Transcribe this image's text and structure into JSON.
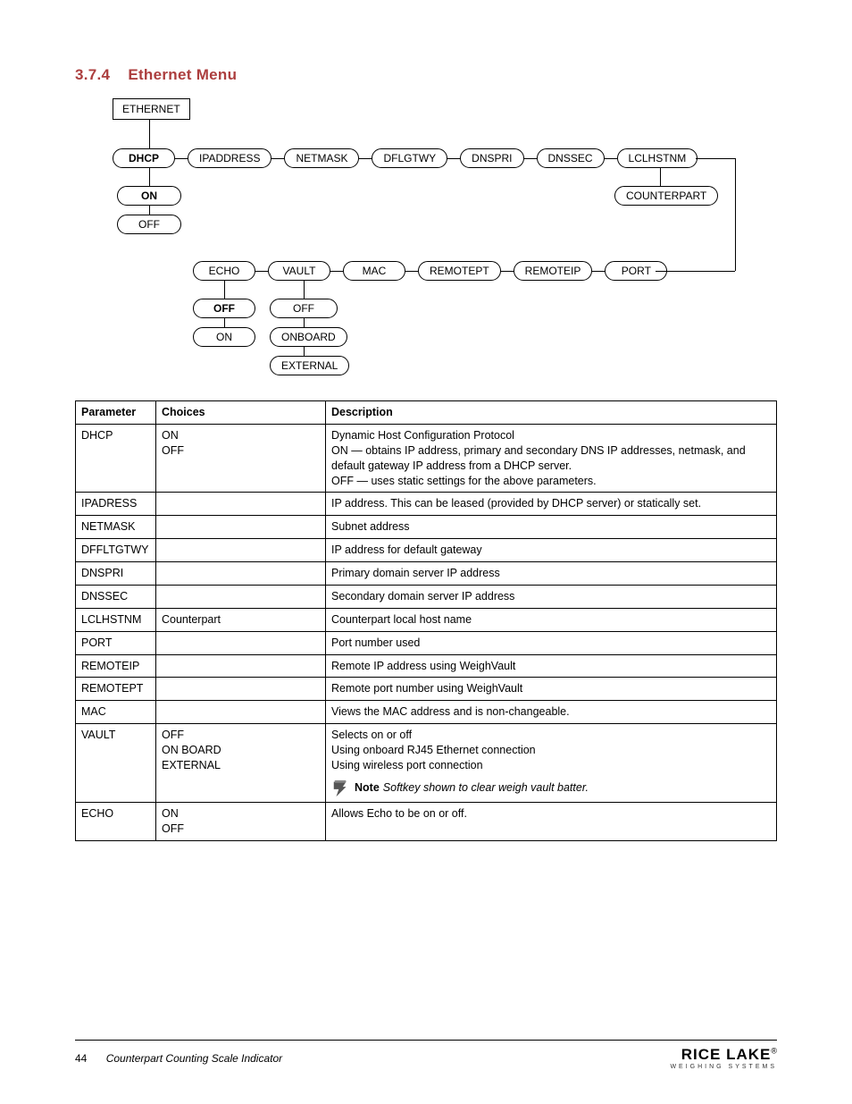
{
  "heading": {
    "number": "3.7.4",
    "title": "Ethernet Menu"
  },
  "diagram": {
    "root": "ETHERNET",
    "row1": [
      "DHCP",
      "IPADDRESS",
      "NETMASK",
      "DFLGTWY",
      "DNSPRI",
      "DNSSEC",
      "LCLHSTNM"
    ],
    "row1_bold_idx": 0,
    "dhcp_children": [
      "ON",
      "OFF"
    ],
    "dhcp_bold_idx": 0,
    "lcl_child": "COUNTERPART",
    "row2": [
      "ECHO",
      "VAULT",
      "MAC",
      "REMOTEPT",
      "REMOTEIP",
      "PORT"
    ],
    "echo_children": [
      "OFF",
      "ON"
    ],
    "echo_bold_idx": 0,
    "vault_children": [
      "OFF",
      "ONBOARD",
      "EXTERNAL"
    ]
  },
  "table": {
    "headers": [
      "Parameter",
      "Choices",
      "Description"
    ],
    "rows": [
      {
        "param": "DHCP",
        "choices": "ON\nOFF",
        "desc": "Dynamic Host Configuration Protocol\nON — obtains IP address, primary and secondary DNS IP addresses, netmask, and default gateway IP address from a DHCP server.\nOFF — uses static settings for the above parameters."
      },
      {
        "param": "IPADRESS",
        "choices": "",
        "desc": "IP address. This can be leased (provided by DHCP server) or statically set."
      },
      {
        "param": "NETMASK",
        "choices": "",
        "desc": "Subnet address"
      },
      {
        "param": "DFFLTGTWY",
        "choices": "",
        "desc": "IP address for default gateway"
      },
      {
        "param": "DNSPRI",
        "choices": "",
        "desc": "Primary domain server IP address"
      },
      {
        "param": "DNSSEC",
        "choices": "",
        "desc": "Secondary domain server IP address"
      },
      {
        "param": "LCLHSTNM",
        "choices": "Counterpart",
        "desc": "Counterpart local host name"
      },
      {
        "param": "PORT",
        "choices": "",
        "desc": "Port number used"
      },
      {
        "param": "REMOTEIP",
        "choices": "",
        "desc": "Remote IP address using WeighVault"
      },
      {
        "param": "REMOTEPT",
        "choices": "",
        "desc": "Remote port number using WeighVault"
      },
      {
        "param": "MAC",
        "choices": "",
        "desc": "Views the MAC address and is non-changeable."
      },
      {
        "param": "VAULT",
        "choices": "OFF\nON BOARD\nEXTERNAL",
        "desc": "Selects on or off\nUsing onboard RJ45 Ethernet connection\nUsing wireless port connection",
        "note_label": "Note",
        "note_text": "Softkey shown to clear weigh vault batter."
      },
      {
        "param": "ECHO",
        "choices": "ON\nOFF",
        "desc": "Allows Echo to be on or off."
      }
    ]
  },
  "footer": {
    "page": "44",
    "title": "Counterpart Counting Scale Indicator",
    "brand": "RICE LAKE",
    "brand_sub": "WEIGHING SYSTEMS",
    "reg": "®"
  }
}
